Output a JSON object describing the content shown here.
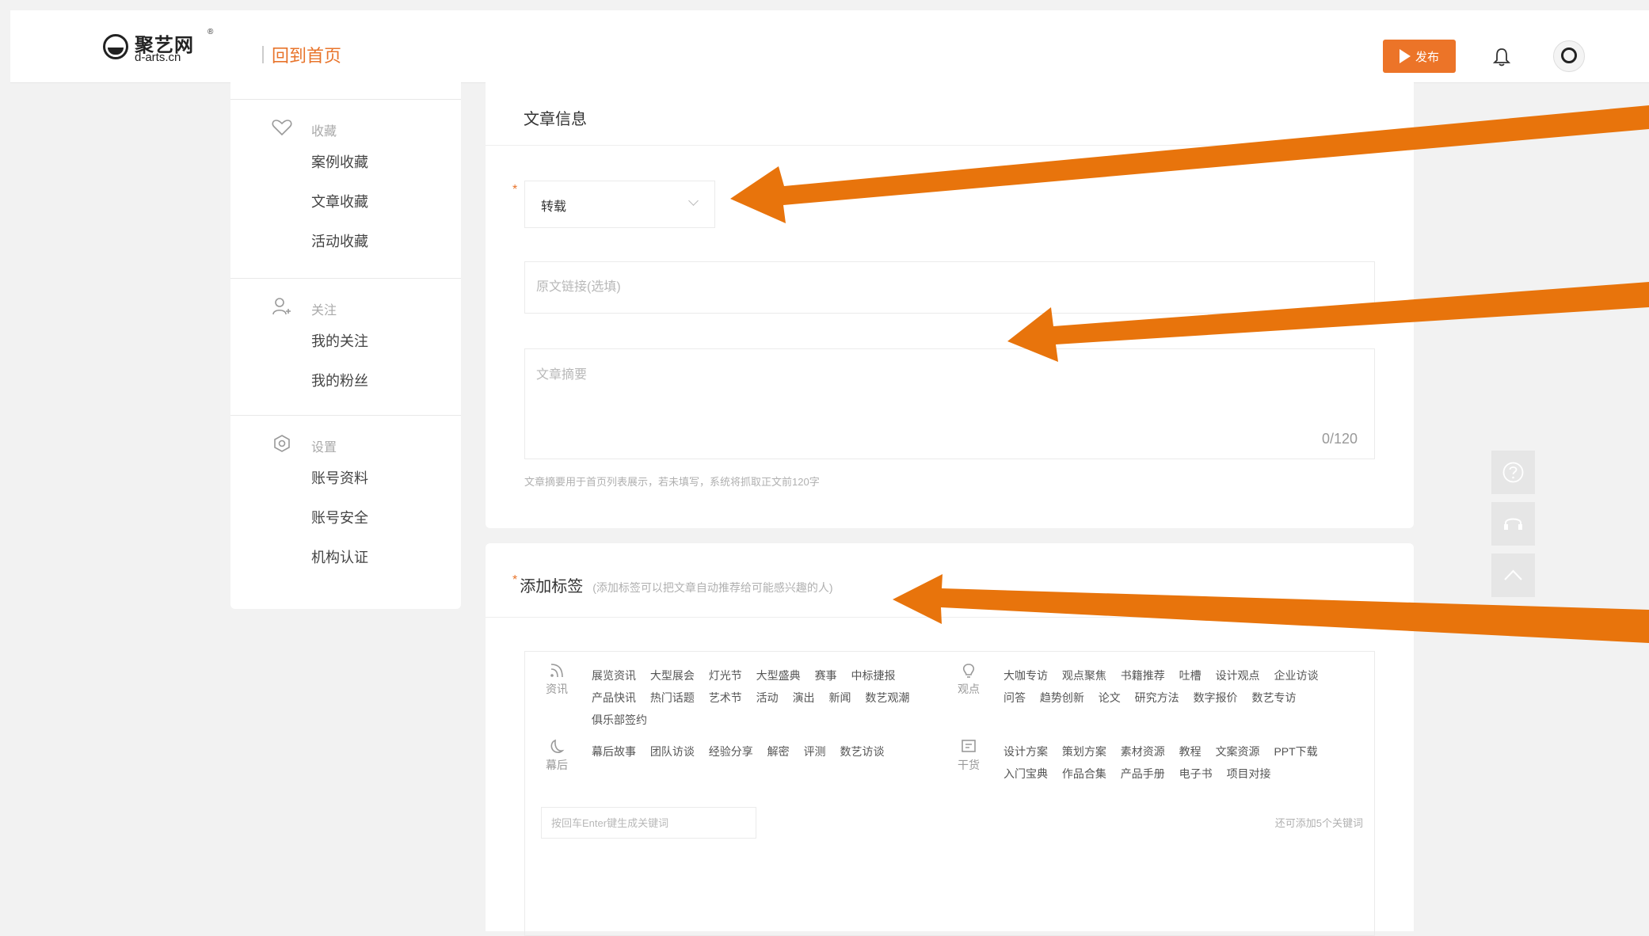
{
  "header": {
    "logo_name": "聚艺网",
    "logo_domain": "d-arts.cn",
    "logo_reg": "®",
    "back_home": "回到首页",
    "publish_label": "发布"
  },
  "sidebar": {
    "groups": [
      {
        "title": "收藏",
        "icon": "heart-icon",
        "items": [
          "案例收藏",
          "文章收藏",
          "活动收藏"
        ]
      },
      {
        "title": "关注",
        "icon": "user-add-icon",
        "items": [
          "我的关注",
          "我的粉丝"
        ]
      },
      {
        "title": "设置",
        "icon": "gear-icon",
        "items": [
          "账号资料",
          "账号安全",
          "机构认证"
        ]
      }
    ]
  },
  "article_info": {
    "title": "文章信息",
    "type_value": "转载",
    "url_placeholder": "原文链接(选填)",
    "summary_placeholder": "文章摘要",
    "summary_counter": "0/120",
    "summary_hint": "文章摘要用于首页列表展示，若未填写，系统将抓取正文前120字"
  },
  "tags": {
    "title": "添加标签",
    "subtitle": "(添加标签可以把文章自动推荐给可能感兴趣的人)",
    "categories": [
      {
        "name": "资讯",
        "icon": "rss-icon",
        "tags": [
          "展览资讯",
          "大型展会",
          "灯光节",
          "大型盛典",
          "赛事",
          "中标捷报",
          "产品快讯",
          "热门话题",
          "艺术节",
          "活动",
          "演出",
          "新闻",
          "数艺观潮",
          "俱乐部签约"
        ]
      },
      {
        "name": "观点",
        "icon": "lightbulb-icon",
        "tags": [
          "大咖专访",
          "观点聚焦",
          "书籍推荐",
          "吐槽",
          "设计观点",
          "企业访谈",
          "问答",
          "趋势创新",
          "论文",
          "研究方法",
          "数字报价",
          "数艺专访"
        ]
      },
      {
        "name": "幕后",
        "icon": "moon-icon",
        "tags": [
          "幕后故事",
          "团队访谈",
          "经验分享",
          "解密",
          "评测",
          "数艺访谈"
        ]
      },
      {
        "name": "干货",
        "icon": "notes-icon",
        "tags": [
          "设计方案",
          "策划方案",
          "素材资源",
          "教程",
          "文案资源",
          "PPT下载",
          "入门宝典",
          "作品合集",
          "产品手册",
          "电子书",
          "项目对接"
        ]
      }
    ],
    "keyword_placeholder": "按回车Enter键生成关键词",
    "keyword_remaining": "还可添加5个关键词"
  },
  "colors": {
    "accent": "#ec7428",
    "annotation_arrow": "#e8740c"
  }
}
